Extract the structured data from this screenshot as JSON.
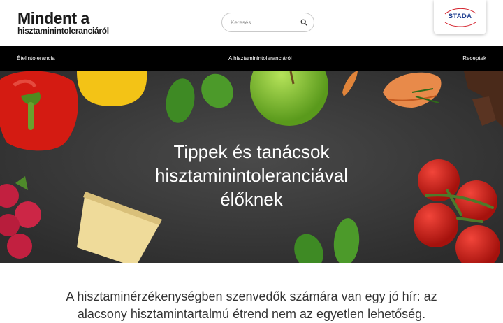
{
  "header": {
    "logo_line1": "Mindent a",
    "logo_line2": "hisztaminintoleranciáról",
    "search_placeholder": "Keresés",
    "brand": "STADA"
  },
  "nav": {
    "items": [
      "Ételintolerancia",
      "A hisztaminintoleranciáról",
      "Receptek"
    ]
  },
  "hero": {
    "title_line1": "Tippek és tanácsok",
    "title_line2": "hisztaminintoleranciával",
    "title_line3": "élőknek"
  },
  "intro": {
    "text": "A hisztaminérzékenységben szenvedők számára van egy jó hír: az alacsony hisztamintartalmú étrend nem az egyetlen lehetőség."
  },
  "colors": {
    "nav_bg": "#000000",
    "brand_blue": "#1d3d8f",
    "brand_red": "#d4232d",
    "hero_bg": "#3b3b3b"
  }
}
